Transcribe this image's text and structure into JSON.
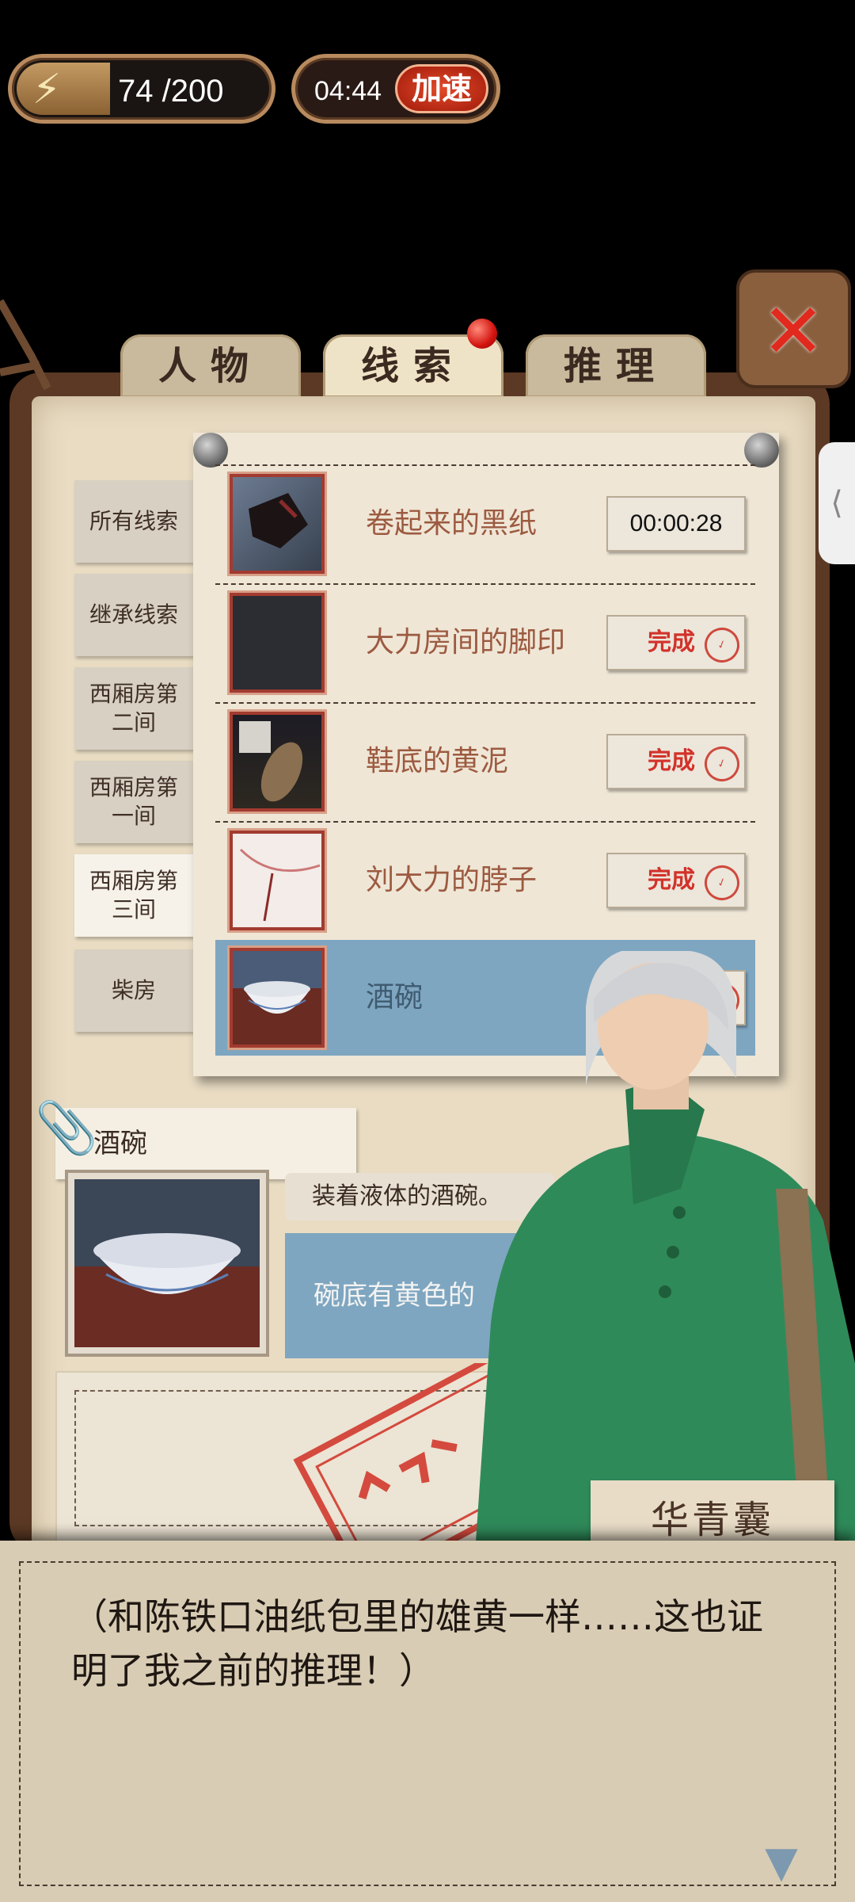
{
  "hud": {
    "energy_icon": "lightning-icon",
    "energy_text": "74 /200",
    "energy_fraction": 0.37,
    "timer_text": "04:44",
    "speed_up_label": "加速"
  },
  "tabs": [
    {
      "label": "人物",
      "active": false
    },
    {
      "label": "线索",
      "active": true,
      "notification": true
    },
    {
      "label": "推理",
      "active": false
    }
  ],
  "categories": [
    {
      "label": "所有线索"
    },
    {
      "label": "继承线索"
    },
    {
      "label": "西厢房第二间"
    },
    {
      "label": "西厢房第一间"
    },
    {
      "label": "西厢房第三间",
      "active": true
    },
    {
      "label": "柴房"
    }
  ],
  "clues": [
    {
      "name": "卷起来的黑纸",
      "status": "00:00:28"
    },
    {
      "name": "大力房间的脚印",
      "status": "完成"
    },
    {
      "name": "鞋底的黄泥",
      "status": "完成"
    },
    {
      "name": "刘大力的脖子",
      "status": "完成"
    },
    {
      "name": "酒碗",
      "status": "完成",
      "active": true
    }
  ],
  "detail": {
    "title": "酒碗",
    "description": "装着液体的酒碗。",
    "note": "碗底有黄色的"
  },
  "character": {
    "name": "华青囊"
  },
  "dialog": {
    "text": "（和陈铁口油纸包里的雄黄一样……这也证明了我之前的推理！）"
  },
  "colors": {
    "accent_red": "#d2322a",
    "selected_blue": "#7ea6c0",
    "paper": "#e9dcc3",
    "robe_green": "#2f8a5a"
  }
}
